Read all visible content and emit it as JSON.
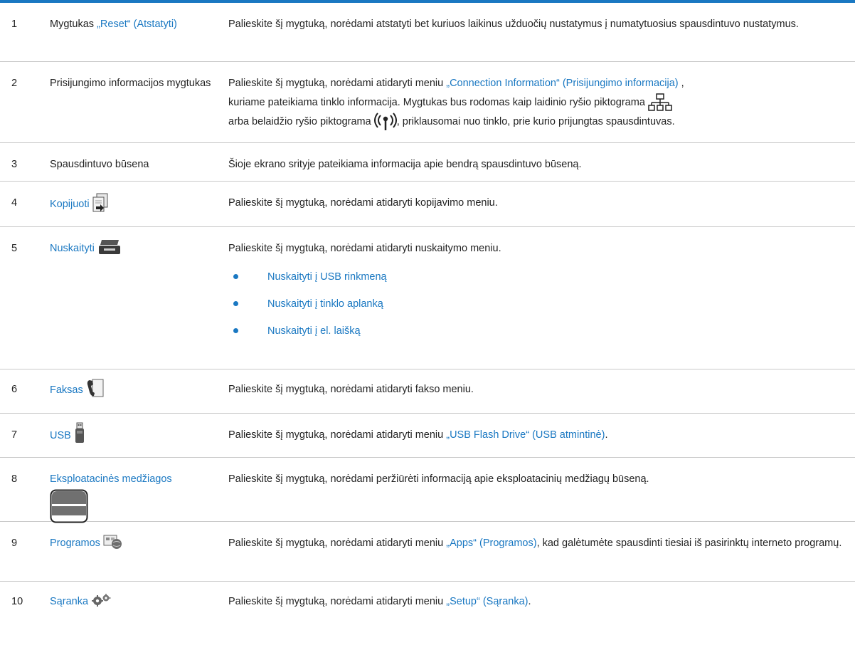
{
  "colors": {
    "accent": "#1a78c2",
    "rule": "#c9c9c9",
    "text": "#222222"
  },
  "rows": [
    {
      "num": "1",
      "item_prefix": "Mygtukas ",
      "item_link": "„Reset“ (Atstatyti)",
      "desc": "Palieskite šį mygtuką, norėdami atstatyti bet kuriuos laikinus užduočių nustatymus į numatytuosius spausdintuvo nustatymus."
    },
    {
      "num": "2",
      "item": "Prisijungimo informacijos mygtukas",
      "desc_a": "Palieskite šį mygtuką, norėdami atidaryti meniu ",
      "desc_link": "„Connection Information“ (Prisijungimo informacija)",
      "desc_b": " ,",
      "desc_c": "kuriame pateikiama tinklo informacija. Mygtukas bus rodomas kaip laidinio ryšio piktograma",
      "desc_d": "arba belaidžio ryšio piktograma",
      "desc_e": ", priklausomai nuo tinklo, prie kurio prijungtas spausdintuvas.",
      "icons": [
        "wired-network-icon",
        "wireless-icon"
      ]
    },
    {
      "num": "3",
      "item": "Spausdintuvo būsena",
      "desc": "Šioje ekrano srityje pateikiama informacija apie bendrą spausdintuvo būseną."
    },
    {
      "num": "4",
      "item_link": "Kopijuoti",
      "icon": "copy-icon",
      "desc": "Palieskite šį mygtuką, norėdami atidaryti kopijavimo meniu."
    },
    {
      "num": "5",
      "item_link": "Nuskaityti",
      "icon": "scan-icon",
      "desc": "Palieskite šį mygtuką, norėdami atidaryti nuskaitymo meniu.",
      "bullets": [
        "Nuskaityti į USB rinkmeną",
        "Nuskaityti į tinklo aplanką",
        "Nuskaityti į el. laišką"
      ]
    },
    {
      "num": "6",
      "item_link": "Faksas",
      "icon": "fax-icon",
      "desc": "Palieskite šį mygtuką, norėdami atidaryti fakso meniu."
    },
    {
      "num": "7",
      "item_link": "USB",
      "icon": "usb-icon",
      "desc_a": "Palieskite šį mygtuką, norėdami atidaryti meniu ",
      "desc_link": "„USB Flash Drive“ (USB atmintinė)",
      "desc_b": "."
    },
    {
      "num": "8",
      "item_link": "Eksploatacinės medžiagos",
      "icon": "supplies-icon",
      "desc": "Palieskite šį mygtuką, norėdami peržiūrėti informaciją apie eksploatacinių medžiagų būseną."
    },
    {
      "num": "9",
      "item_link": "Programos",
      "icon": "apps-icon",
      "desc_a": "Palieskite šį mygtuką, norėdami atidaryti meniu ",
      "desc_link": "„Apps“ (Programos)",
      "desc_b": ", kad galėtumėte spausdinti tiesiai iš pasirinktų interneto programų."
    },
    {
      "num": "10",
      "item_link": "Sąranka",
      "icon": "setup-icon",
      "desc_a": "Palieskite šį mygtuką, norėdami atidaryti meniu ",
      "desc_link": "„Setup“ (Sąranka)",
      "desc_b": "."
    }
  ]
}
